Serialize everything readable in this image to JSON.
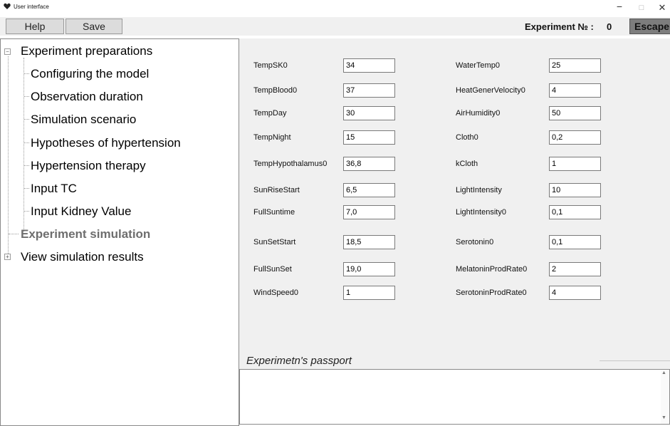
{
  "window": {
    "title": "User interface",
    "icon": "heart-icon"
  },
  "toolbar": {
    "help_label": "Help",
    "save_label": "Save",
    "experiment_label": "Experiment №  :",
    "experiment_value": "0",
    "escape_label": "Escape"
  },
  "tree": {
    "preparations": "Experiment preparations",
    "children": [
      "Configuring the model",
      "Observation duration",
      "Simulation scenario",
      "Hypotheses of hypertension",
      "Hypertension therapy",
      "Input TC",
      "Input Kidney Value"
    ],
    "simulation": "Experiment simulation",
    "results": "View simulation results"
  },
  "form": {
    "left": [
      {
        "label": "TempSK0",
        "value": "34"
      },
      {
        "label": "TempBlood0",
        "value": "37"
      },
      {
        "label": "TempDay",
        "value": "30"
      },
      {
        "label": "TempNight",
        "value": "15"
      },
      {
        "label": "TempHypothalamus0",
        "value": "36,8"
      },
      {
        "label": "SunRiseStart",
        "value": "6,5"
      },
      {
        "label": "FullSuntime",
        "value": "7,0"
      },
      {
        "label": "SunSetStart",
        "value": "18,5"
      },
      {
        "label": "FullSunSet",
        "value": "19,0"
      },
      {
        "label": "WindSpeed0",
        "value": "1"
      }
    ],
    "right": [
      {
        "label": "WaterTemp0",
        "value": "25"
      },
      {
        "label": "HeatGenerVelocity0",
        "value": "4"
      },
      {
        "label": "AirHumidity0",
        "value": "50"
      },
      {
        "label": "Cloth0",
        "value": "0,2"
      },
      {
        "label": "kCloth",
        "value": "1"
      },
      {
        "label": "LightIntensity",
        "value": "10"
      },
      {
        "label": "LightIntensity0",
        "value": "0,1"
      },
      {
        "label": "Serotonin0",
        "value": "0,1"
      },
      {
        "label": "MelatoninProdRate0",
        "value": "2"
      },
      {
        "label": "SerotoninProdRate0",
        "value": "4"
      }
    ]
  },
  "passport": {
    "title": "Experimetn's passport",
    "text": ""
  }
}
